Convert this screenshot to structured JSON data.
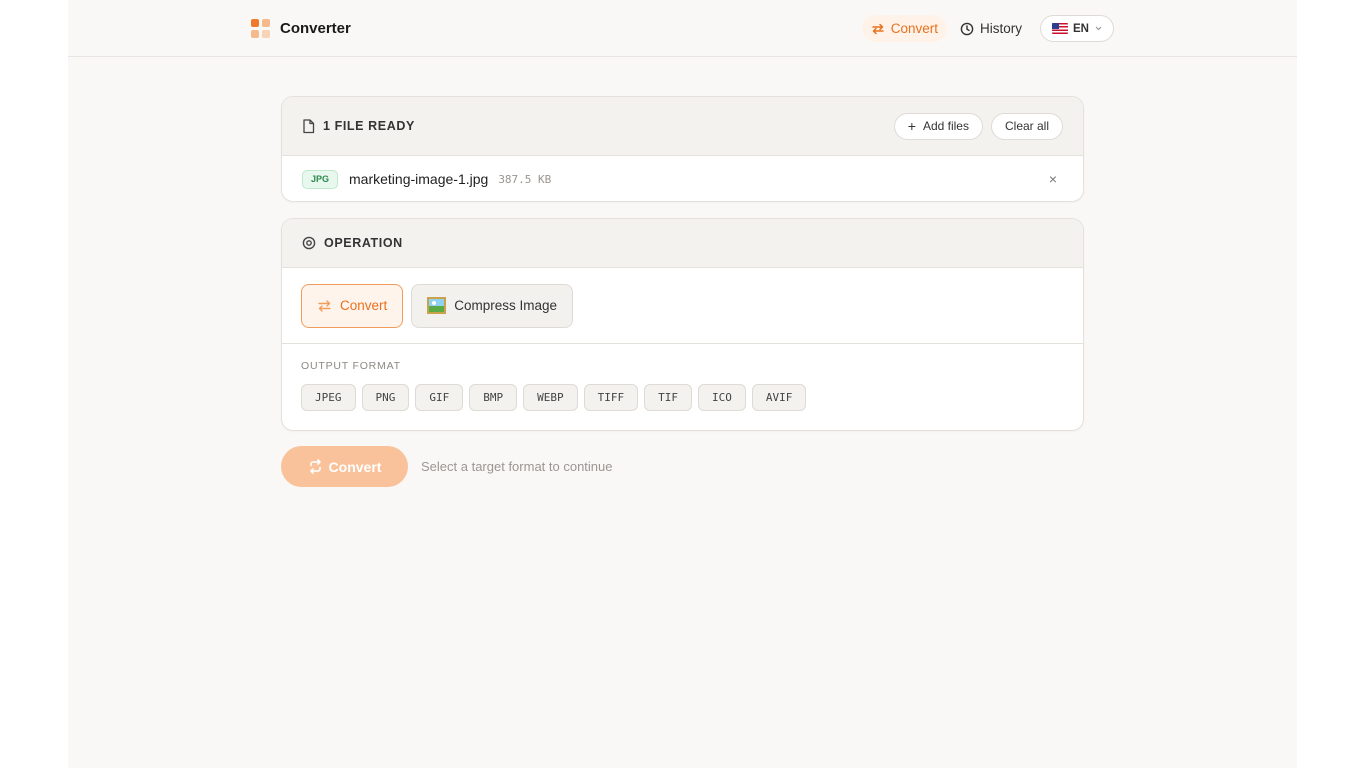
{
  "header": {
    "brand": "Converter",
    "logo_colors": [
      "#f07a2b",
      "#f6b98c",
      "#f6b98c",
      "#f9d3b5"
    ],
    "nav": [
      {
        "label": "Convert",
        "icon": "swap-arrows-icon",
        "active": true
      },
      {
        "label": "History",
        "icon": "clock-icon",
        "active": false
      }
    ],
    "language": {
      "code": "EN",
      "flag": "us-flag-icon"
    }
  },
  "files": {
    "title": "1 FILE READY",
    "add_label": "Add files",
    "clear_label": "Clear all",
    "items": [
      {
        "type": "JPG",
        "name": "marketing-image-1.jpg",
        "size": "387.5 KB"
      }
    ]
  },
  "operation": {
    "title": "OPERATION",
    "options": [
      {
        "label": "Convert",
        "icon": "swap-arrows-icon",
        "selected": true
      },
      {
        "label": "Compress Image",
        "icon": "framed-picture-icon",
        "selected": false
      }
    ],
    "output_label": "OUTPUT FORMAT",
    "formats": [
      "JPEG",
      "PNG",
      "GIF",
      "BMP",
      "WEBP",
      "TIFF",
      "TIF",
      "ICO",
      "AVIF"
    ]
  },
  "action": {
    "convert_label": "Convert",
    "hint": "Select a target format to continue"
  },
  "colors": {
    "accent": "#e8711f",
    "accent_disabled": "#f9c29a",
    "badge_green": "#2d8a4e"
  }
}
